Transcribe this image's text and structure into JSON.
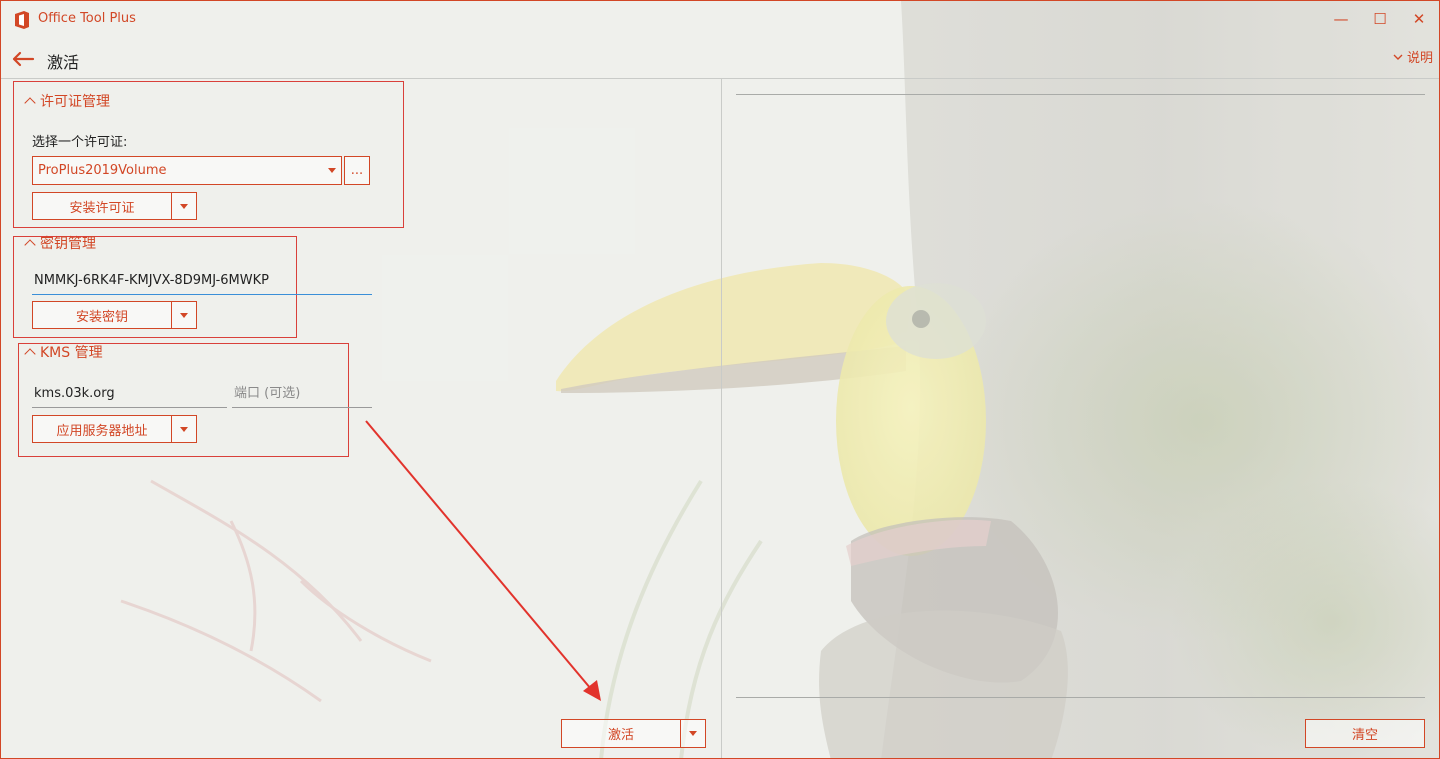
{
  "window": {
    "title": "Office Tool Plus",
    "controls": {
      "minimize": "—",
      "maximize": "☐",
      "close": "✕"
    }
  },
  "nav": {
    "page_title": "激活",
    "help_label": "说明"
  },
  "license": {
    "header": "许可证管理",
    "select_label": "选择一个许可证:",
    "selected": "ProPlus2019Volume",
    "browse_label": "...",
    "install_button": "安装许可证"
  },
  "key": {
    "header": "密钥管理",
    "value": "NMMKJ-6RK4F-KMJVX-8D9MJ-6MWKP",
    "install_button": "安装密钥"
  },
  "kms": {
    "header": "KMS 管理",
    "server": "kms.03k.org",
    "port_placeholder": "端口 (可选)",
    "apply_button": "应用服务器地址"
  },
  "actions": {
    "activate_button": "激活",
    "clear_button": "清空"
  },
  "colors": {
    "accent": "#d24726",
    "annotation": "#d9403a",
    "focus": "#3a8fd8"
  }
}
